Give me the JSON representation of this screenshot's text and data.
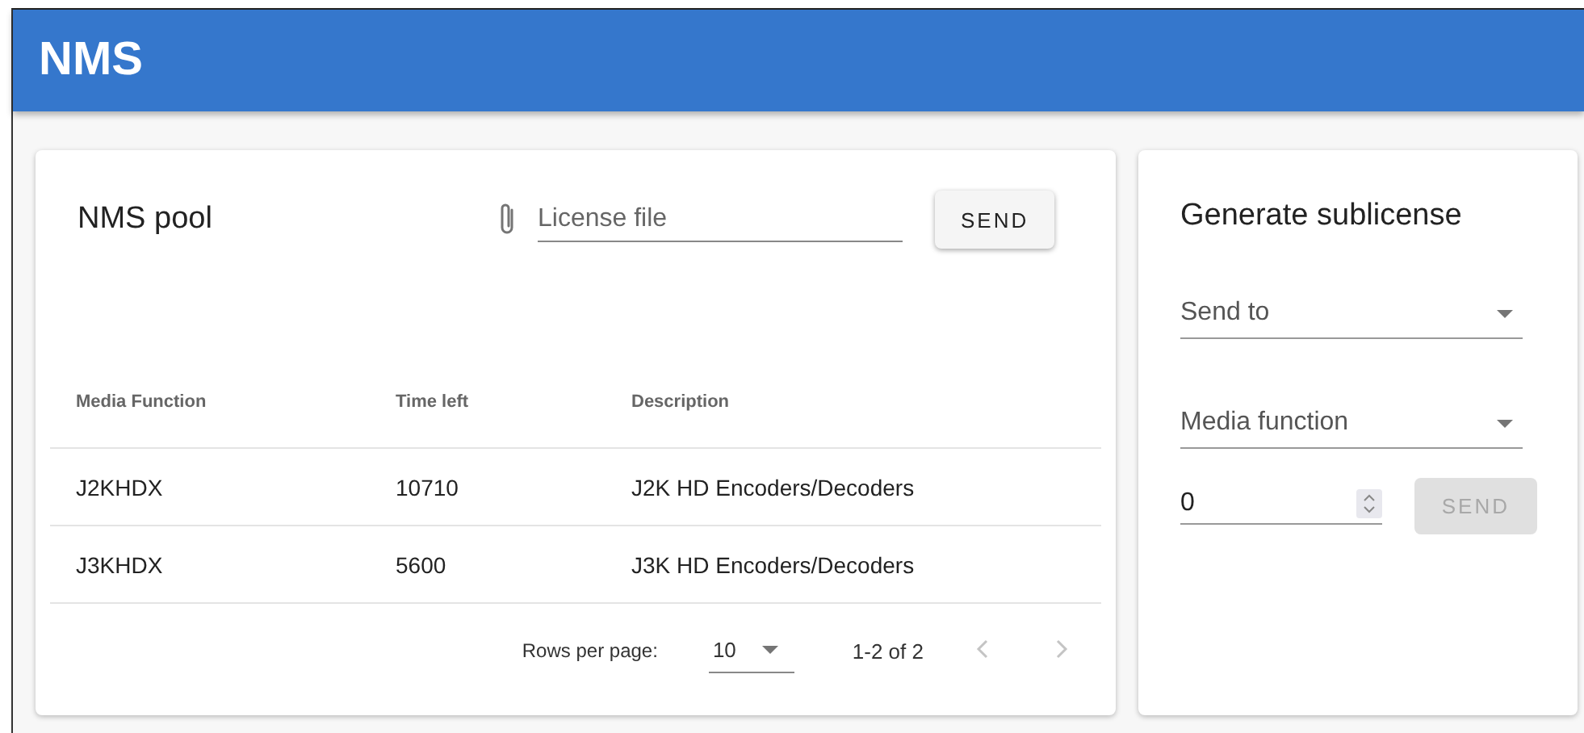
{
  "app_bar": {
    "title": "NMS"
  },
  "pool": {
    "title": "NMS pool",
    "file_field": {
      "placeholder": "License file"
    },
    "send_button": {
      "label": "SEND",
      "disabled": false
    },
    "table": {
      "columns": [
        "Media Function",
        "Time left",
        "Description"
      ],
      "rows": [
        [
          "J2KHDX",
          "10710",
          "J2K HD Encoders/Decoders"
        ],
        [
          "J3KHDX",
          "5600",
          "J3K HD Encoders/Decoders"
        ]
      ]
    },
    "pagination": {
      "rows_label": "Rows per page:",
      "rows_value": "10",
      "range": "1-2 of 2",
      "prev_disabled": true,
      "next_disabled": true
    }
  },
  "sublicense": {
    "title": "Generate sublicense",
    "selects": [
      {
        "placeholder": "Send to"
      },
      {
        "placeholder": "Media function"
      }
    ],
    "amount": {
      "value": "0"
    },
    "send_button": {
      "label": "SEND",
      "disabled": true
    }
  }
}
